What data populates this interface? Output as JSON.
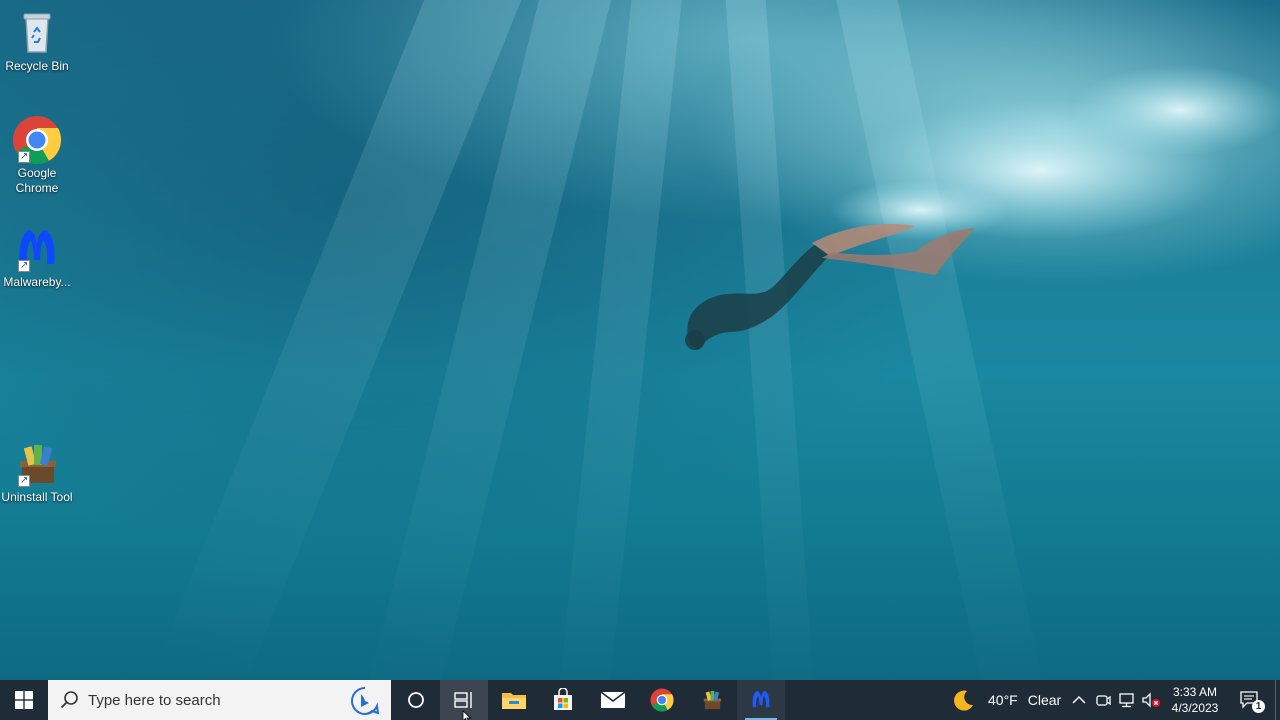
{
  "desktop": {
    "icons": [
      {
        "label": "Recycle Bin",
        "icon": "recycle-bin-icon"
      },
      {
        "label": "Google\nChrome",
        "icon": "chrome-icon"
      },
      {
        "label": "Malwareby...",
        "icon": "malwarebytes-icon"
      },
      {
        "label": "Uninstall Tool",
        "icon": "uninstall-tool-icon"
      }
    ]
  },
  "taskbar": {
    "search_placeholder": "Type here to search",
    "pinned": [
      "cortana-icon",
      "task-view-icon",
      "file-explorer-icon",
      "microsoft-store-icon",
      "mail-icon",
      "chrome-icon",
      "uninstall-tool-icon",
      "malwarebytes-icon"
    ],
    "weather": {
      "temp": "40°F",
      "condition": "Clear",
      "icon": "moon-icon"
    },
    "tray_icons": [
      "chevron-up-icon",
      "meet-now-icon",
      "network-icon",
      "volume-muted-icon"
    ],
    "clock": {
      "time": "3:33 AM",
      "date": "4/3/2023"
    },
    "notifications": {
      "count": "1",
      "icon": "action-center-icon"
    }
  }
}
